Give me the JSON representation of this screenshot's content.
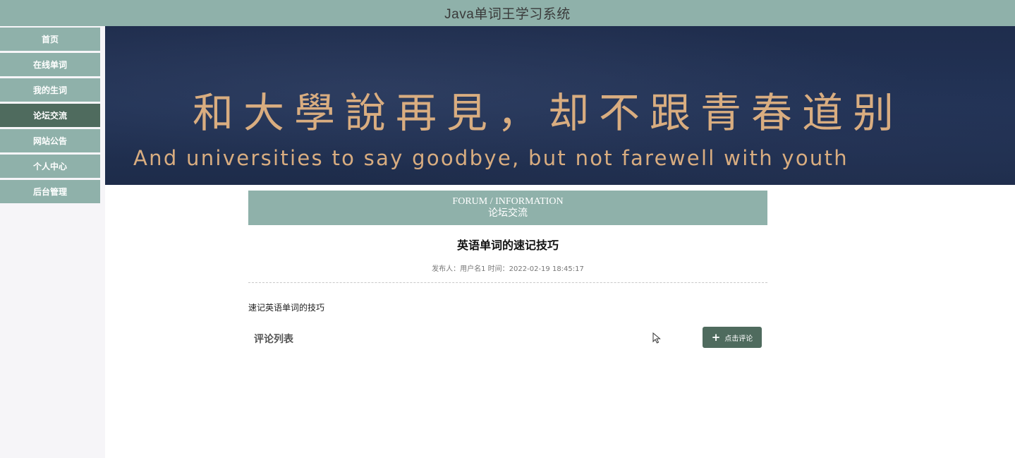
{
  "header": {
    "title": "Java单词王学习系统"
  },
  "sidebar": {
    "items": [
      {
        "label": "首页",
        "active": false
      },
      {
        "label": "在线单词",
        "active": false
      },
      {
        "label": "我的生词",
        "active": false
      },
      {
        "label": "论坛交流",
        "active": true
      },
      {
        "label": "网站公告",
        "active": false
      },
      {
        "label": "个人中心",
        "active": false
      },
      {
        "label": "后台管理",
        "active": false
      }
    ]
  },
  "banner": {
    "headline": "和大學說再見，却不跟青春道别",
    "subline": "And universities to say goodbye, but not farewell with youth"
  },
  "section": {
    "title_en": "FORUM / INFORMATION",
    "title_cn": "论坛交流"
  },
  "post": {
    "title": "英语单词的速记技巧",
    "meta": "发布人：用户名1 时间：2022-02-19 18:45:17",
    "body": "速记英语单词的技巧"
  },
  "comments": {
    "title": "评论列表",
    "button_label": "点击评论",
    "button_icon": "plus-icon"
  },
  "colors": {
    "accent": "#8fb1aa",
    "active": "#4f6b5e",
    "banner_bg": "#1f2d4d",
    "banner_text": "#d9ad80"
  }
}
